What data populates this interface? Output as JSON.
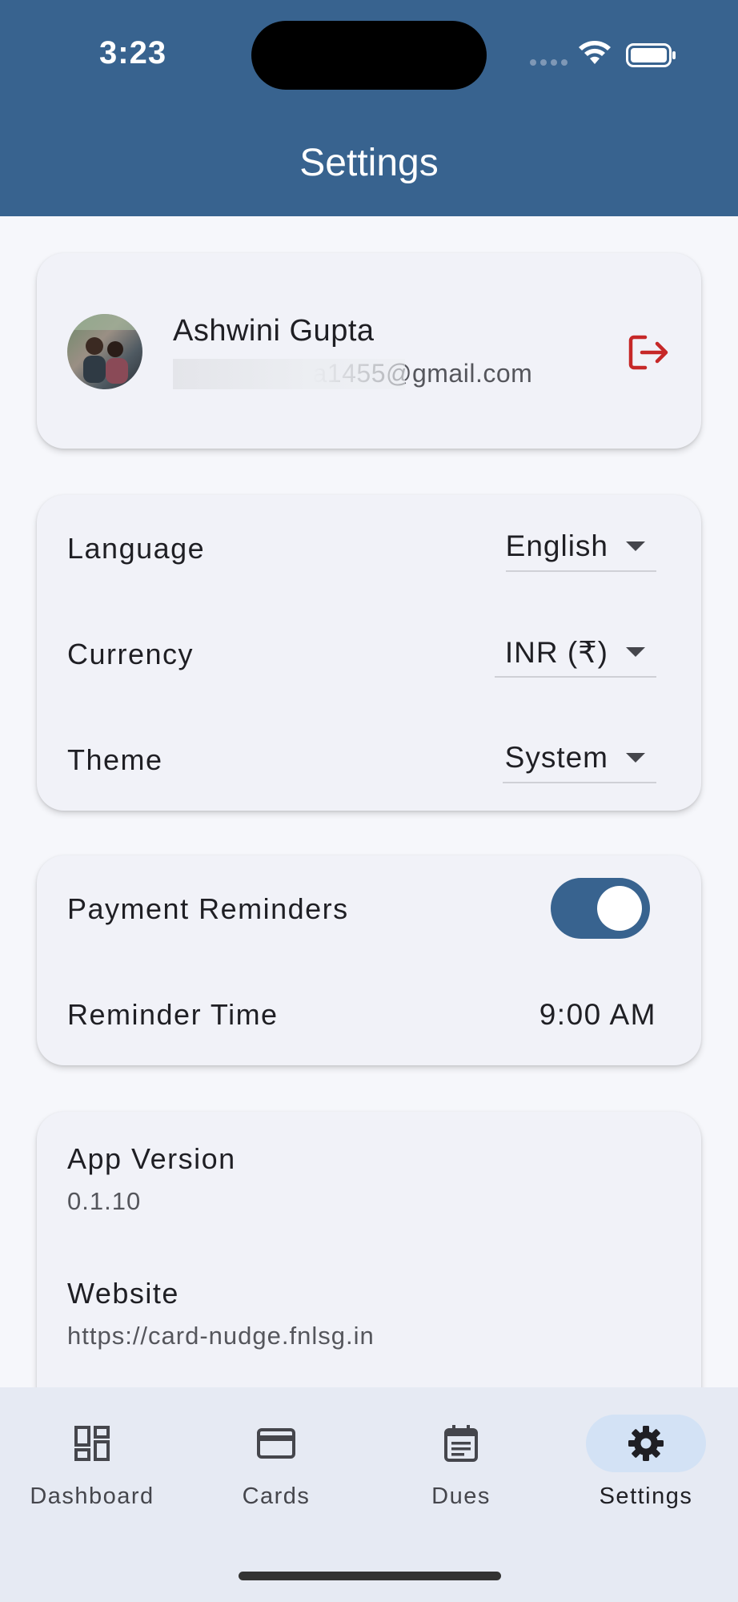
{
  "status_bar": {
    "time": "3:23"
  },
  "header": {
    "title": "Settings"
  },
  "profile": {
    "name": "Ashwini Gupta",
    "email": "ashwinigupta1455@gmail.com"
  },
  "preferences": {
    "language": {
      "label": "Language",
      "value": "English"
    },
    "currency": {
      "label": "Currency",
      "value": "INR (₹)"
    },
    "theme": {
      "label": "Theme",
      "value": "System"
    }
  },
  "notifications": {
    "payment_reminders": {
      "label": "Payment Reminders",
      "enabled": true
    },
    "reminder_time": {
      "label": "Reminder Time",
      "value": "9:00 AM"
    }
  },
  "about": {
    "app_version": {
      "label": "App Version",
      "value": "0.1.10"
    },
    "website": {
      "label": "Website",
      "value": "https://card-nudge.fnlsg.in"
    }
  },
  "bottom_nav": {
    "items": [
      {
        "label": "Dashboard",
        "icon": "dashboard-icon",
        "active": false
      },
      {
        "label": "Cards",
        "icon": "credit-card-icon",
        "active": false
      },
      {
        "label": "Dues",
        "icon": "calendar-icon",
        "active": false
      },
      {
        "label": "Settings",
        "icon": "gear-icon",
        "active": true
      }
    ]
  },
  "colors": {
    "primary": "#38638f",
    "logout": "#c62828",
    "background": "#f6f7fb",
    "card": "#f1f2f8",
    "nav_active_pill": "#d3e2f5"
  }
}
